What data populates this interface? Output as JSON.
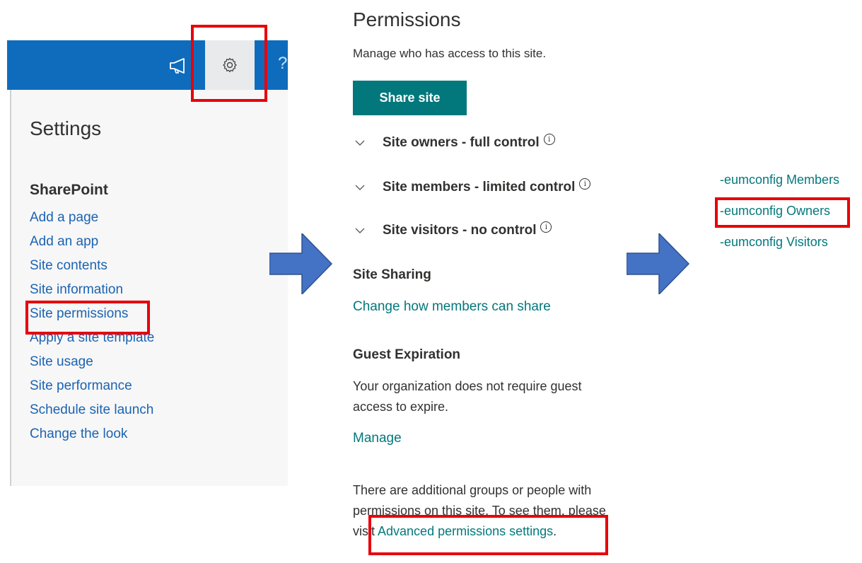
{
  "settings_panel": {
    "title": "Settings",
    "section_title": "SharePoint",
    "links": [
      "Add a page",
      "Add an app",
      "Site contents",
      "Site information",
      "Site permissions",
      "Apply a site template",
      "Site usage",
      "Site performance",
      "Schedule site launch",
      "Change the look"
    ],
    "suite_bar": {
      "question_glyph": "?",
      "icons": [
        "megaphone-icon",
        "gear-icon"
      ],
      "color": "#0f6cbd"
    }
  },
  "permissions_panel": {
    "title": "Permissions",
    "subtitle": "Manage who has access to this site.",
    "share_button": "Share site",
    "groups": [
      "Site owners - full control",
      "Site members - limited control",
      "Site visitors - no control"
    ],
    "info_glyph": "i",
    "site_sharing": {
      "heading": "Site Sharing",
      "link": "Change how members can share"
    },
    "guest_expiration": {
      "heading": "Guest Expiration",
      "text_line1": "Your organization does not require guest",
      "text_line2": "access to expire.",
      "link": "Manage"
    },
    "additional": {
      "line1": "There are additional groups or people with",
      "line2": "permissions on this site. To see them, please",
      "line3_prefix": "visit ",
      "link": "Advanced permissions settings",
      "suffix": "."
    },
    "accent_color": "#03787c"
  },
  "groups_panel": {
    "links": [
      "-eumconfig Members",
      "-eumconfig Owners",
      "-eumconfig Visitors"
    ]
  },
  "annotation_color": "#e8000b",
  "arrow_color": "#4472c4"
}
